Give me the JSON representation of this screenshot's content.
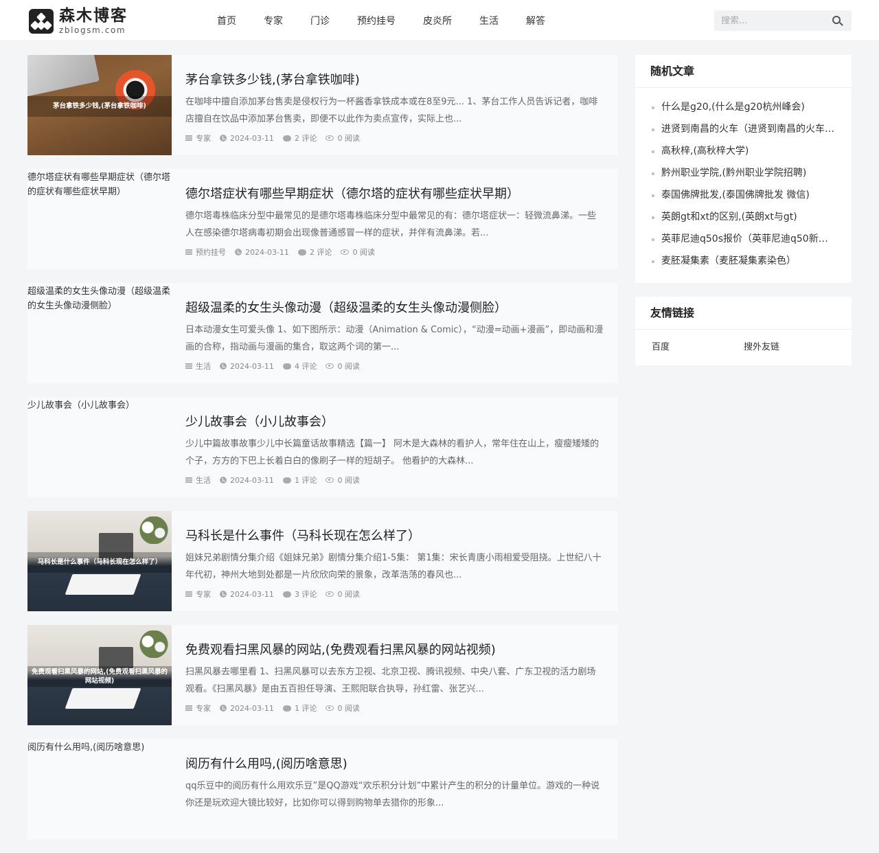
{
  "site": {
    "title": "森木博客",
    "subtitle": "zblogsm.com"
  },
  "nav": [
    "首页",
    "专家",
    "门诊",
    "预约挂号",
    "皮炎所",
    "生活",
    "解答"
  ],
  "search": {
    "placeholder": "搜索..."
  },
  "posts": [
    {
      "title": "茅台拿铁多少钱,(茅台拿铁咖啡)",
      "excerpt": "在咖啡中擅自添加茅台售卖是侵权行为一杯酱香拿铁成本或在8至9元... 1、茅台工作人员告诉记者，咖啡店擅自在饮品中添加茅台售卖，即便不以此作为卖点宣传，实际上也...",
      "category": "专家",
      "date": "2024-03-11",
      "comments": "2 评论",
      "views": "0 阅读",
      "thumb_caption": "茅台拿铁多少钱,(茅台拿铁咖啡)",
      "thumb_style": "desk"
    },
    {
      "title": "德尔塔症状有哪些早期症状（德尔塔的症状有哪些症状早期）",
      "excerpt": "德尔塔毒株临床分型中最常见的是德尔塔毒株临床分型中最常见的有：德尔塔症状一：轻微流鼻涕。一些人在感染德尔塔病毒初期会出现像普通感冒一样的症状，并伴有流鼻涕。若...",
      "category": "预约挂号",
      "date": "2024-03-11",
      "comments": "2 评论",
      "views": "0 阅读",
      "thumb_alt": "德尔塔症状有哪些早期症状（德尔塔的症状有哪些症状早期）"
    },
    {
      "title": "超级温柔的女生头像动漫（超级温柔的女生头像动漫侧脸）",
      "excerpt": "日本动漫女生可爱头像 1、如下图所示：动漫（Animation & Comic），“动漫=动画+漫画”，即动画和漫画的合称，指动画与漫画的集合，取这两个词的第一...",
      "category": "生活",
      "date": "2024-03-11",
      "comments": "4 评论",
      "views": "0 阅读",
      "thumb_alt": "超级温柔的女生头像动漫（超级温柔的女生头像动漫侧脸）"
    },
    {
      "title": "少儿故事会（小儿故事会）",
      "excerpt": "少儿中篇故事故事少儿中长篇童话故事精选【篇一】 阿木是大森林的看护人，常年住在山上，瘦瘦矮矮的个子，方方的下巴上长着白白的像刷子一样的短胡子。 他看护的大森林...",
      "category": "生活",
      "date": "2024-03-11",
      "comments": "1 评论",
      "views": "0 阅读",
      "thumb_alt": "少儿故事会（小儿故事会）"
    },
    {
      "title": "马科长是什么事件（马科长现在怎么样了）",
      "excerpt": "姐妹兄弟剧情分集介绍《姐妹兄弟》剧情分集介绍1-5集： 第1集：宋长青唐小雨相爱受阻挠。上世纪八十年代初，神州大地到处都是一片欣欣向荣的景象，改革浩荡的春风也...",
      "category": "专家",
      "date": "2024-03-11",
      "comments": "3 评论",
      "views": "0 阅读",
      "thumb_caption": "马科长是什么事件（马科长现在怎么样了）",
      "thumb_style": "room"
    },
    {
      "title": "免费观看扫黑风暴的网站,(免费观看扫黑风暴的网站视频)",
      "excerpt": "扫黑风暴去哪里看 1、扫黑风暴可以去东方卫视、北京卫视、腾讯视频、中央八套、广东卫视的活力剧场观看。《扫黑风暴》是由五百担任导演、王熙阳联合执导，孙红雷、张艺兴...",
      "category": "专家",
      "date": "2024-03-11",
      "comments": "1 评论",
      "views": "0 阅读",
      "thumb_caption": "免费观看扫黑风暴的网站,(免费观看扫黑风暴的网站视频)",
      "thumb_style": "room"
    },
    {
      "title": "阅历有什么用吗,(阅历啥意思)",
      "excerpt": "qq乐豆中的阅历有什么用欢乐豆”是QQ游戏“欢乐积分计划”中累计产生的积分的计量单位。游戏的一种说你还是玩欢迎大镜比较好，比如你可以得到购物单去猎你的形象...",
      "category": "",
      "date": "",
      "comments": "",
      "views": "",
      "thumb_alt": "阅历有什么用吗,(阅历啥意思)"
    }
  ],
  "sidebar": {
    "random_title": "随机文章",
    "random_items": [
      "什么是g20,(什么是g20杭州峰会)",
      "进贤到南昌的火车（进贤到南昌的火车时刻表）",
      "高秋梓,(高秋梓大学)",
      "黔州职业学院,(黔州职业学院招聘)",
      "泰国佛牌批发,(泰国佛牌批发 微信)",
      "英朗gt和xt的区别,(英朗xt与gt)",
      "英菲尼迪q50s报价（英菲尼迪q50新款报价）",
      "麦胚凝集素（麦胚凝集素染色）"
    ],
    "links_title": "友情链接",
    "links": [
      "百度",
      "搜外友链"
    ]
  }
}
